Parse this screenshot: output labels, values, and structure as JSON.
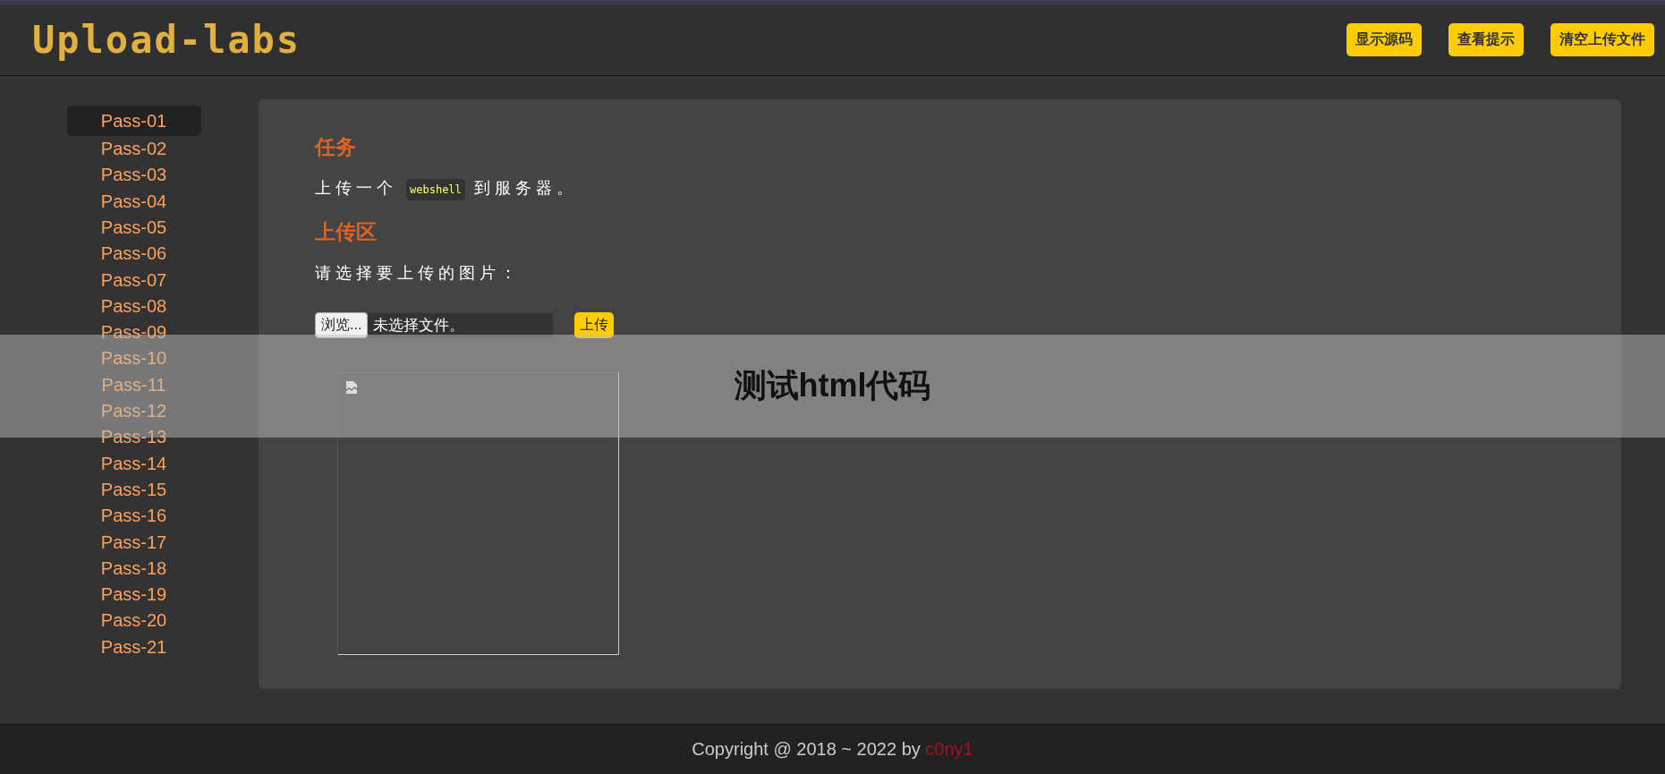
{
  "header": {
    "logo": "Upload-labs",
    "buttons": [
      "显示源码",
      "查看提示",
      "清空上传文件"
    ]
  },
  "sidebar": {
    "items": [
      {
        "label": "Pass-01",
        "selected": true
      },
      {
        "label": "Pass-02",
        "selected": false
      },
      {
        "label": "Pass-03",
        "selected": false
      },
      {
        "label": "Pass-04",
        "selected": false
      },
      {
        "label": "Pass-05",
        "selected": false
      },
      {
        "label": "Pass-06",
        "selected": false
      },
      {
        "label": "Pass-07",
        "selected": false
      },
      {
        "label": "Pass-08",
        "selected": false
      },
      {
        "label": "Pass-09",
        "selected": false
      },
      {
        "label": "Pass-10",
        "selected": false
      },
      {
        "label": "Pass-11",
        "selected": false
      },
      {
        "label": "Pass-12",
        "selected": false
      },
      {
        "label": "Pass-13",
        "selected": false
      },
      {
        "label": "Pass-14",
        "selected": false
      },
      {
        "label": "Pass-15",
        "selected": false
      },
      {
        "label": "Pass-16",
        "selected": false
      },
      {
        "label": "Pass-17",
        "selected": false
      },
      {
        "label": "Pass-18",
        "selected": false
      },
      {
        "label": "Pass-19",
        "selected": false
      },
      {
        "label": "Pass-20",
        "selected": false
      },
      {
        "label": "Pass-21",
        "selected": false
      }
    ]
  },
  "task": {
    "heading": "任务",
    "text_before": "上传一个",
    "code": "webshell",
    "text_after": "到服务器。"
  },
  "upload": {
    "heading": "上传区",
    "prompt": "请选择要上传的图片：",
    "browse_button": "浏览...",
    "file_status": "未选择文件。",
    "submit_button": "上传"
  },
  "overlay": {
    "text": "测试html代码"
  },
  "footer": {
    "text": "Copyright @ 2018 ~ 2022 by",
    "author": "c0ny1"
  }
}
